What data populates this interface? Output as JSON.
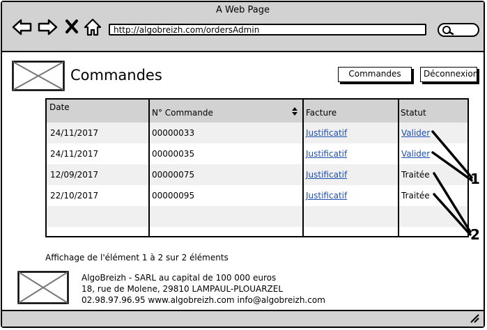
{
  "browser": {
    "window_title": "A Web Page",
    "url": "http://algobreizh.com/ordersAdmin",
    "nav_icons": [
      "back-arrow-icon",
      "forward-arrow-icon",
      "close-icon",
      "home-icon"
    ],
    "search_icon": "search-icon"
  },
  "header": {
    "page_title": "Commandes",
    "buttons": {
      "commandes": "Commandes",
      "deconnexion": "Déconnexion"
    }
  },
  "table": {
    "columns": [
      "Date",
      "N° Commande",
      "Facture",
      "Statut"
    ],
    "rows": [
      {
        "date": "24/11/2017",
        "number": "00000033",
        "invoice": "Justificatif",
        "status": "Valider",
        "status_is_link": true
      },
      {
        "date": "24/11/2017",
        "number": "00000035",
        "invoice": "Justificatif",
        "status": "Valider",
        "status_is_link": true
      },
      {
        "date": "12/09/2017",
        "number": "00000075",
        "invoice": "Justificatif",
        "status": "Traitée",
        "status_is_link": false
      },
      {
        "date": "22/10/2017",
        "number": "00000095",
        "invoice": "Justificatif",
        "status": "Traitée",
        "status_is_link": false
      }
    ]
  },
  "summary": "Affichage de l'élément 1 à 2 sur 2 éléments",
  "footer": {
    "line1": "AlgoBreizh - SARL au capital de 100 000 euros",
    "line2": "18, rue de Molene, 29810 LAMPAUL-PLOUARZEL",
    "line3": "02.98.97.96.95 www.algobreizh.com info@algobreizh.com"
  },
  "callouts": [
    "1",
    "2"
  ],
  "colors": {
    "chrome": "#d2d2d2",
    "link": "#1e4fb0",
    "row_alt": "#f0f0f0"
  }
}
